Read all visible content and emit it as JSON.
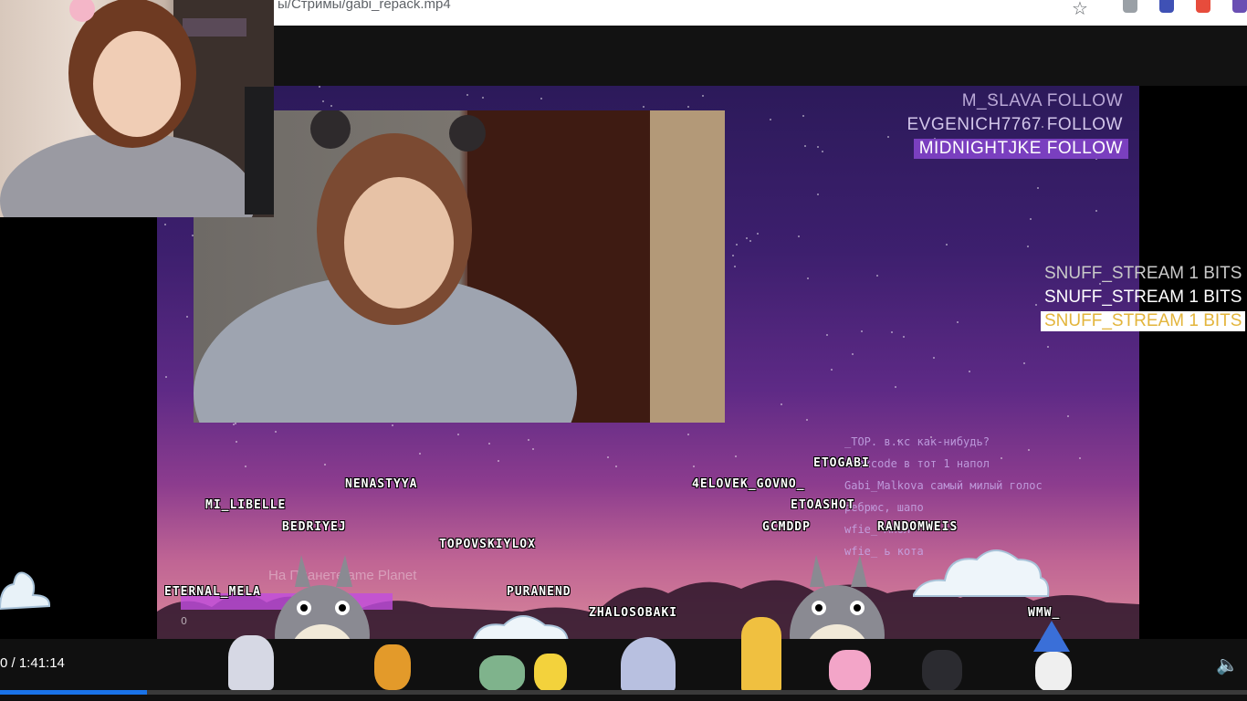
{
  "browser": {
    "url_fragment": "ы/Стримы/gabi_repack.mp4"
  },
  "followers": [
    {
      "name": "M_SLAVA FOLLOW",
      "color": "#b9a8d6"
    },
    {
      "name": "EVGENICH7767 FOLLOW",
      "color": "#d2c6ea"
    },
    {
      "name": "MIDNIGHTJKE FOLLOW",
      "color": "#ffffff",
      "highlight": "#7a3fbf"
    }
  ],
  "bits": [
    {
      "text": "SNUFF_STREAM 1 BITS",
      "color": "#c9c9c9"
    },
    {
      "text": "SNUFF_STREAM 1 BITS",
      "color": "#ffffff"
    },
    {
      "text": "SNUFF_STREAM 1 BITS",
      "color": "#e3b53c",
      "background": "#ffffff"
    }
  ],
  "chat_names": [
    {
      "id": "nenastyya",
      "text": "NENASTYYA"
    },
    {
      "id": "mi_libelle",
      "text": "MI_LIBELLE"
    },
    {
      "id": "bedriyej",
      "text": "BEDRIYEJ"
    },
    {
      "id": "topovskiylox",
      "text": "TOPOVSKIYLOX"
    },
    {
      "id": "eternal",
      "text": "ETERNAL_MELA"
    },
    {
      "id": "puranend",
      "text": "PURANEND"
    },
    {
      "id": "zhalosobaki",
      "text": "ZHALOSOBAKI"
    },
    {
      "id": "etogabi",
      "text": "ETOGABI"
    },
    {
      "id": "4elovek",
      "text": "4ELOVEK_GOVNO_"
    },
    {
      "id": "etoashot",
      "text": "ETOASHOT"
    },
    {
      "id": "gcmddp",
      "text": "GCMDDP"
    },
    {
      "id": "randomweis",
      "text": "RANDOMWEIS"
    },
    {
      "id": "wmw",
      "text": "WMW_"
    }
  ],
  "blurred_chat": [
    "_TOP.  в.кс как-нибудь?",
    "1ааxcode  в тот 1 напол",
    "Gabi_Malkova  самый милый голос",
    "  ребрюс, шапо",
    "wfie_  мнол",
    "wfie_  ь кота"
  ],
  "game_overlay_text": "На Планете ame Planet",
  "game_counter": "0",
  "player": {
    "time": "0 / 1:41:14",
    "progress_fraction": 0.118
  },
  "colors": {
    "accent": "#1a73e8",
    "follow_highlight": "#7a3fbf"
  }
}
